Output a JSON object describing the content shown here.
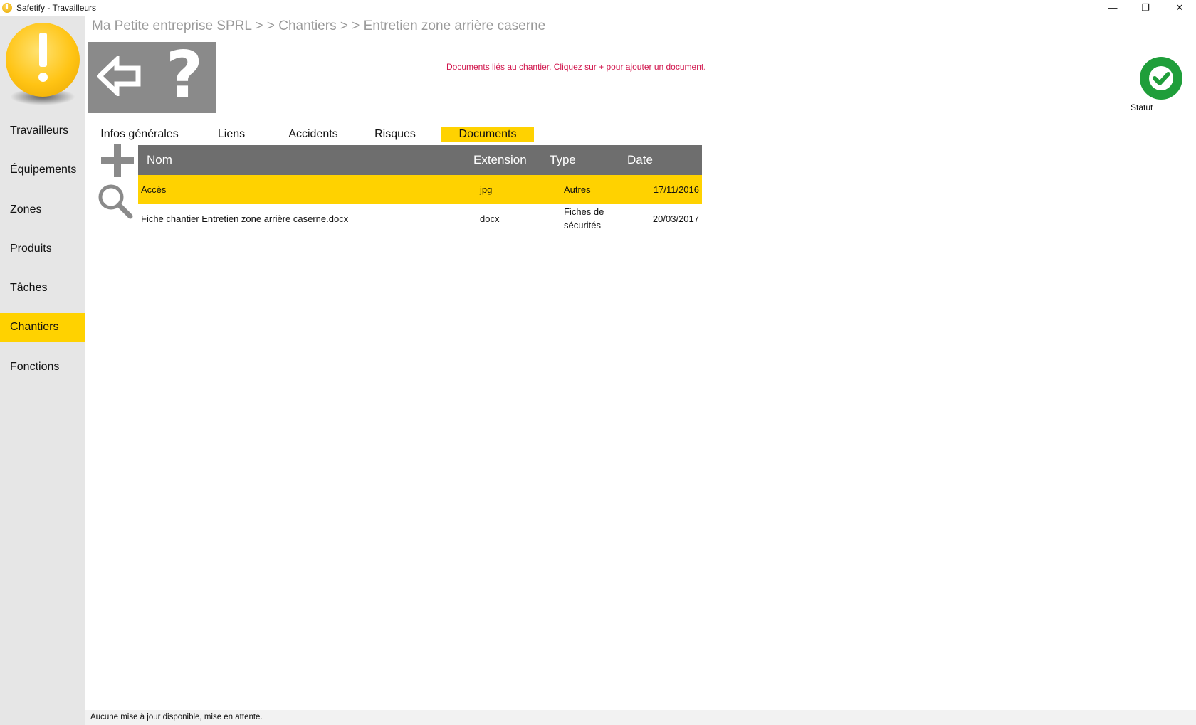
{
  "window": {
    "title": "Safetify - Travailleurs",
    "min": "—",
    "max": "❐",
    "close": "✕"
  },
  "sidebar": {
    "items": [
      {
        "label": "Travailleurs"
      },
      {
        "label": "Équipements"
      },
      {
        "label": "Zones"
      },
      {
        "label": "Produits"
      },
      {
        "label": "Tâches"
      },
      {
        "label": "Chantiers",
        "active": true
      },
      {
        "label": "Fonctions"
      }
    ]
  },
  "breadcrumb": "Ma Petite entreprise SPRL  > >  Chantiers  > >  Entretien zone arrière caserne",
  "toolbar": {
    "back_icon": "back-arrow-icon",
    "help_label": "?"
  },
  "info_message": "Documents liés au chantier. Cliquez sur + pour ajouter un document.",
  "status": {
    "label": "Statut",
    "color": "#1f9e3a"
  },
  "tabs": [
    {
      "label": "Infos générales"
    },
    {
      "label": "Liens"
    },
    {
      "label": "Accidents"
    },
    {
      "label": "Risques"
    },
    {
      "label": "Documents",
      "active": true
    }
  ],
  "table": {
    "columns": {
      "nom": "Nom",
      "extension": "Extension",
      "type": "Type",
      "date": "Date"
    },
    "rows": [
      {
        "nom": "Accès",
        "extension": "jpg",
        "type": "Autres",
        "date": "17/11/2016",
        "selected": true
      },
      {
        "nom": "Fiche chantier Entretien zone arrière caserne.docx",
        "extension": "docx",
        "type": "Fiches de sécurités",
        "date": "20/03/2017"
      }
    ]
  },
  "statusbar": "Aucune mise à jour disponible, mise en attente.",
  "colors": {
    "accent": "#ffd200",
    "sidebar_bg": "#e6e6e6",
    "header_bg": "#6e6e6e",
    "message": "#d1164d"
  }
}
